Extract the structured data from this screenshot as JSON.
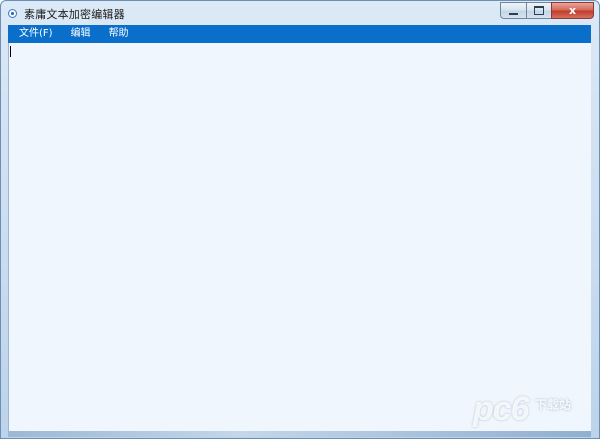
{
  "window": {
    "title": "素庸文本加密编辑器",
    "app_icon": "app-ring-icon",
    "buttons": {
      "minimize": "minimize-icon",
      "maximize": "maximize-icon",
      "close": "close-icon",
      "close_glyph": "x"
    }
  },
  "menubar": {
    "items": [
      {
        "label": "文件(F)"
      },
      {
        "label": "编辑"
      },
      {
        "label": "帮助"
      }
    ],
    "background_color": "#0a6fcb"
  },
  "editor": {
    "content": "",
    "background_color": "#f0f6fd"
  },
  "watermark": {
    "main": "pc6",
    "sub": "下载站"
  }
}
